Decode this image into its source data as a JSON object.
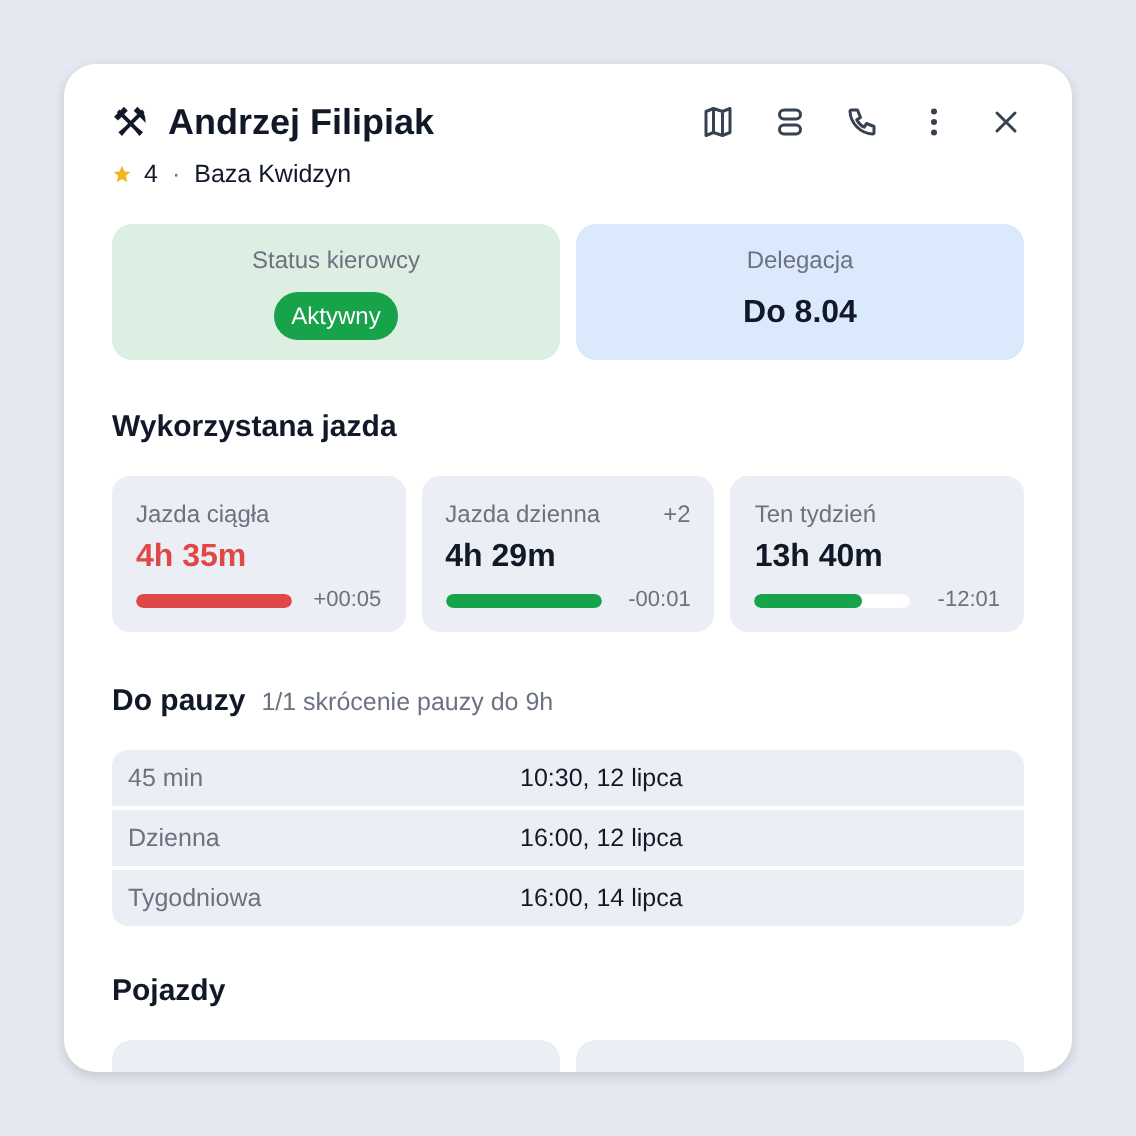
{
  "header": {
    "icon": "⚒",
    "title": "Andrzej Filipiak",
    "rating": "4",
    "separator": "·",
    "base": "Baza Kwidzyn"
  },
  "status_tiles": [
    {
      "kind": "badge",
      "label": "Status kierowcy",
      "value": "Aktywny"
    },
    {
      "kind": "text",
      "label": "Delegacja",
      "value": "Do 8.04"
    }
  ],
  "driving": {
    "title": "Wykorzystana jazda",
    "metrics": [
      {
        "label": "Jazda ciągła",
        "value": "4h 35m",
        "level": 1.0,
        "over": true,
        "delta": "+00:05"
      },
      {
        "label": "Jazda dzienna",
        "extra": "+2",
        "value": "4h 29m",
        "level": 1.0,
        "over": false,
        "delta": "-00:01"
      },
      {
        "label": "Ten tydzień",
        "value": "13h 40m",
        "level": 0.69,
        "over": false,
        "delta": "-12:01"
      }
    ]
  },
  "breaks": {
    "title": "Do pauzy",
    "note": "1/1 skrócenie pauzy do 9h",
    "rows": [
      {
        "type": "45 min",
        "time": "10:30, 12 lipca"
      },
      {
        "type": "Dzienna",
        "time": "16:00, 12 lipca"
      },
      {
        "type": "Tygodniowa",
        "time": "16:00, 14 lipca"
      }
    ]
  },
  "vehicles": {
    "title": "Pojazdy",
    "cards": [
      {
        "kind": "blank"
      },
      {
        "kind": "blank"
      }
    ]
  }
}
